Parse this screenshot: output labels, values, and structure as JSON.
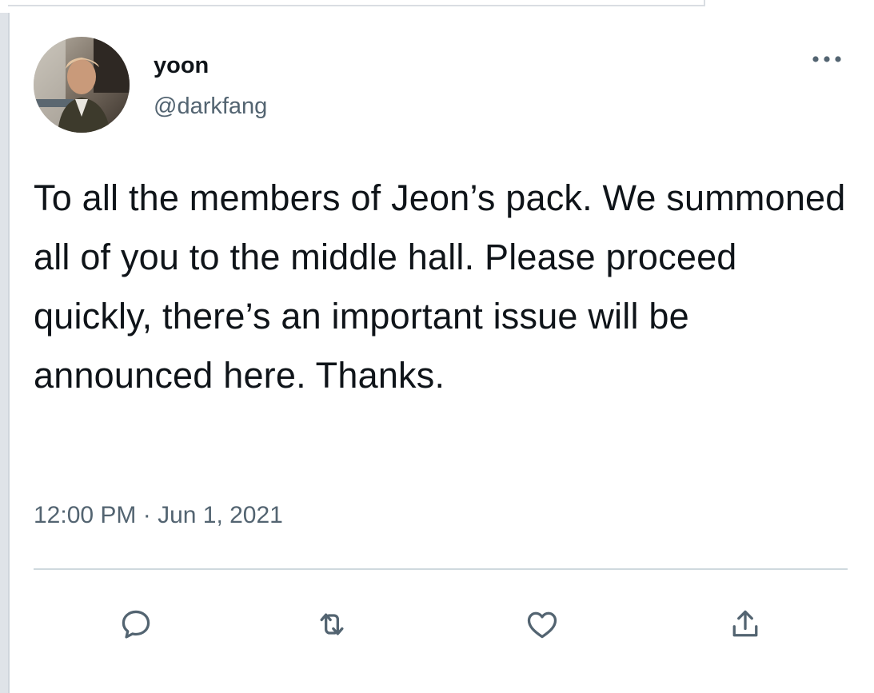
{
  "tweet": {
    "display_name": "yoon",
    "handle": "@darkfang",
    "text": "To all the members of Jeon’s pack. We summoned all of you to the middle hall. Please proceed quickly, there’s an important issue will be announced here. Thanks.",
    "timestamp": "12:00 PM · Jun 1, 2021"
  },
  "icons": {
    "more": "more-options-icon",
    "reply": "reply-icon",
    "retweet": "retweet-icon",
    "like": "heart-icon",
    "share": "share-icon"
  },
  "colors": {
    "text_primary": "#0f1419",
    "text_secondary": "#536471",
    "divider": "#cfd9de"
  }
}
